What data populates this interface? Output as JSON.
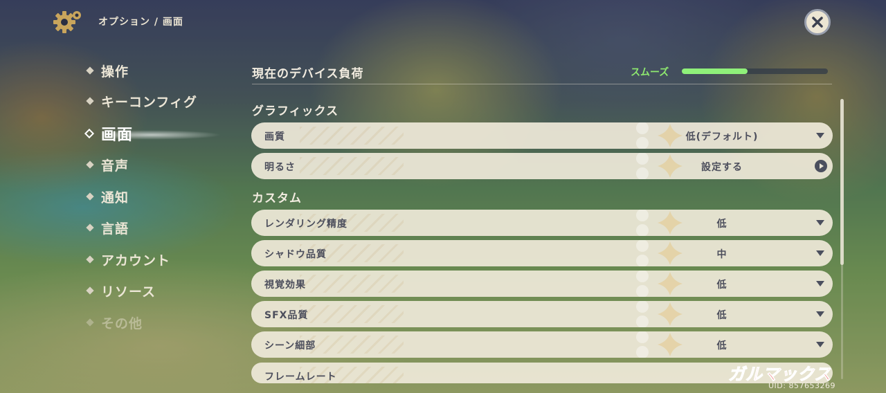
{
  "header": {
    "breadcrumb": "オプション / 画面",
    "icon": "gear-icon",
    "close_icon": "close-icon"
  },
  "sidebar": {
    "items": [
      {
        "label": "操作",
        "state": "normal"
      },
      {
        "label": "キーコンフィグ",
        "state": "normal"
      },
      {
        "label": "画面",
        "state": "active"
      },
      {
        "label": "音声",
        "state": "normal"
      },
      {
        "label": "通知",
        "state": "normal"
      },
      {
        "label": "言語",
        "state": "normal"
      },
      {
        "label": "アカウント",
        "state": "normal"
      },
      {
        "label": "リソース",
        "state": "normal"
      },
      {
        "label": "その他",
        "state": "faded"
      }
    ]
  },
  "device_load": {
    "title": "現在のデバイス負荷",
    "status": "スムーズ",
    "level": 0.45,
    "status_color": "#8fea6f"
  },
  "sections": {
    "graphics": "グラフィックス",
    "custom": "カスタム"
  },
  "rows": [
    {
      "label": "画質",
      "value": "低(デフォルト)",
      "control": "dropdown"
    },
    {
      "label": "明るさ",
      "value": "設定する",
      "control": "action"
    },
    {
      "label": "レンダリング精度",
      "value": "低",
      "control": "dropdown"
    },
    {
      "label": "シャドウ品質",
      "value": "中",
      "control": "dropdown"
    },
    {
      "label": "視覚効果",
      "value": "低",
      "control": "dropdown"
    },
    {
      "label": "SFX品質",
      "value": "低",
      "control": "dropdown"
    },
    {
      "label": "シーン細部",
      "value": "低",
      "control": "dropdown"
    },
    {
      "label": "フレームレート",
      "value": "",
      "control": "dropdown"
    }
  ],
  "watermark": "ガルマックス",
  "uid": "UID: 857653269",
  "colors": {
    "row_bg": "#eee8d8",
    "row_text": "#4c4e5c",
    "accent_green": "#8ff07a"
  }
}
